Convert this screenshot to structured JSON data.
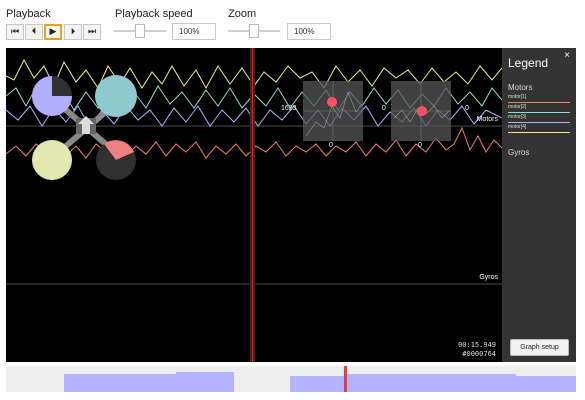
{
  "toolbar": {
    "playback_label": "Playback",
    "speed_label": "Playback speed",
    "zoom_label": "Zoom",
    "buttons": [
      {
        "name": "skip-back-button",
        "glyph": "⏮"
      },
      {
        "name": "step-back-button",
        "glyph": "⏴"
      },
      {
        "name": "play-button",
        "glyph": "▶"
      },
      {
        "name": "step-forward-button",
        "glyph": "⏵"
      },
      {
        "name": "skip-forward-button",
        "glyph": "⏭"
      }
    ],
    "speed_value": "100%",
    "zoom_value": "100%"
  },
  "graph": {
    "motors_label": "Motors",
    "gyros_label": "Gyros",
    "time": "00:15.949",
    "frame": "#0000764",
    "stick_left_top_value": "1623",
    "stick_left_mid_value": "0",
    "stick_left_bottom_value": "0",
    "stick_right_mid_value": "0",
    "stick_right_bottom_value": "0"
  },
  "legend": {
    "title": "Legend",
    "close": "×",
    "motors_group": "Motors",
    "gyros_group": "Gyros",
    "items": [
      {
        "label": "motor[1]",
        "color": "#f08060"
      },
      {
        "label": "motor[2]",
        "color": "#90e0d0"
      },
      {
        "label": "motor[3]",
        "color": "#b0b0ff"
      },
      {
        "label": "motor[4]",
        "color": "#f0f080"
      }
    ],
    "setup_button": "Graph setup"
  },
  "colors": {
    "motor1": "#f08060",
    "motor2": "#90e0d0",
    "motor3": "#b0b0ff",
    "motor4": "#f0f080",
    "cursor": "#c03020",
    "overview_fill": "#b3b3ff"
  }
}
